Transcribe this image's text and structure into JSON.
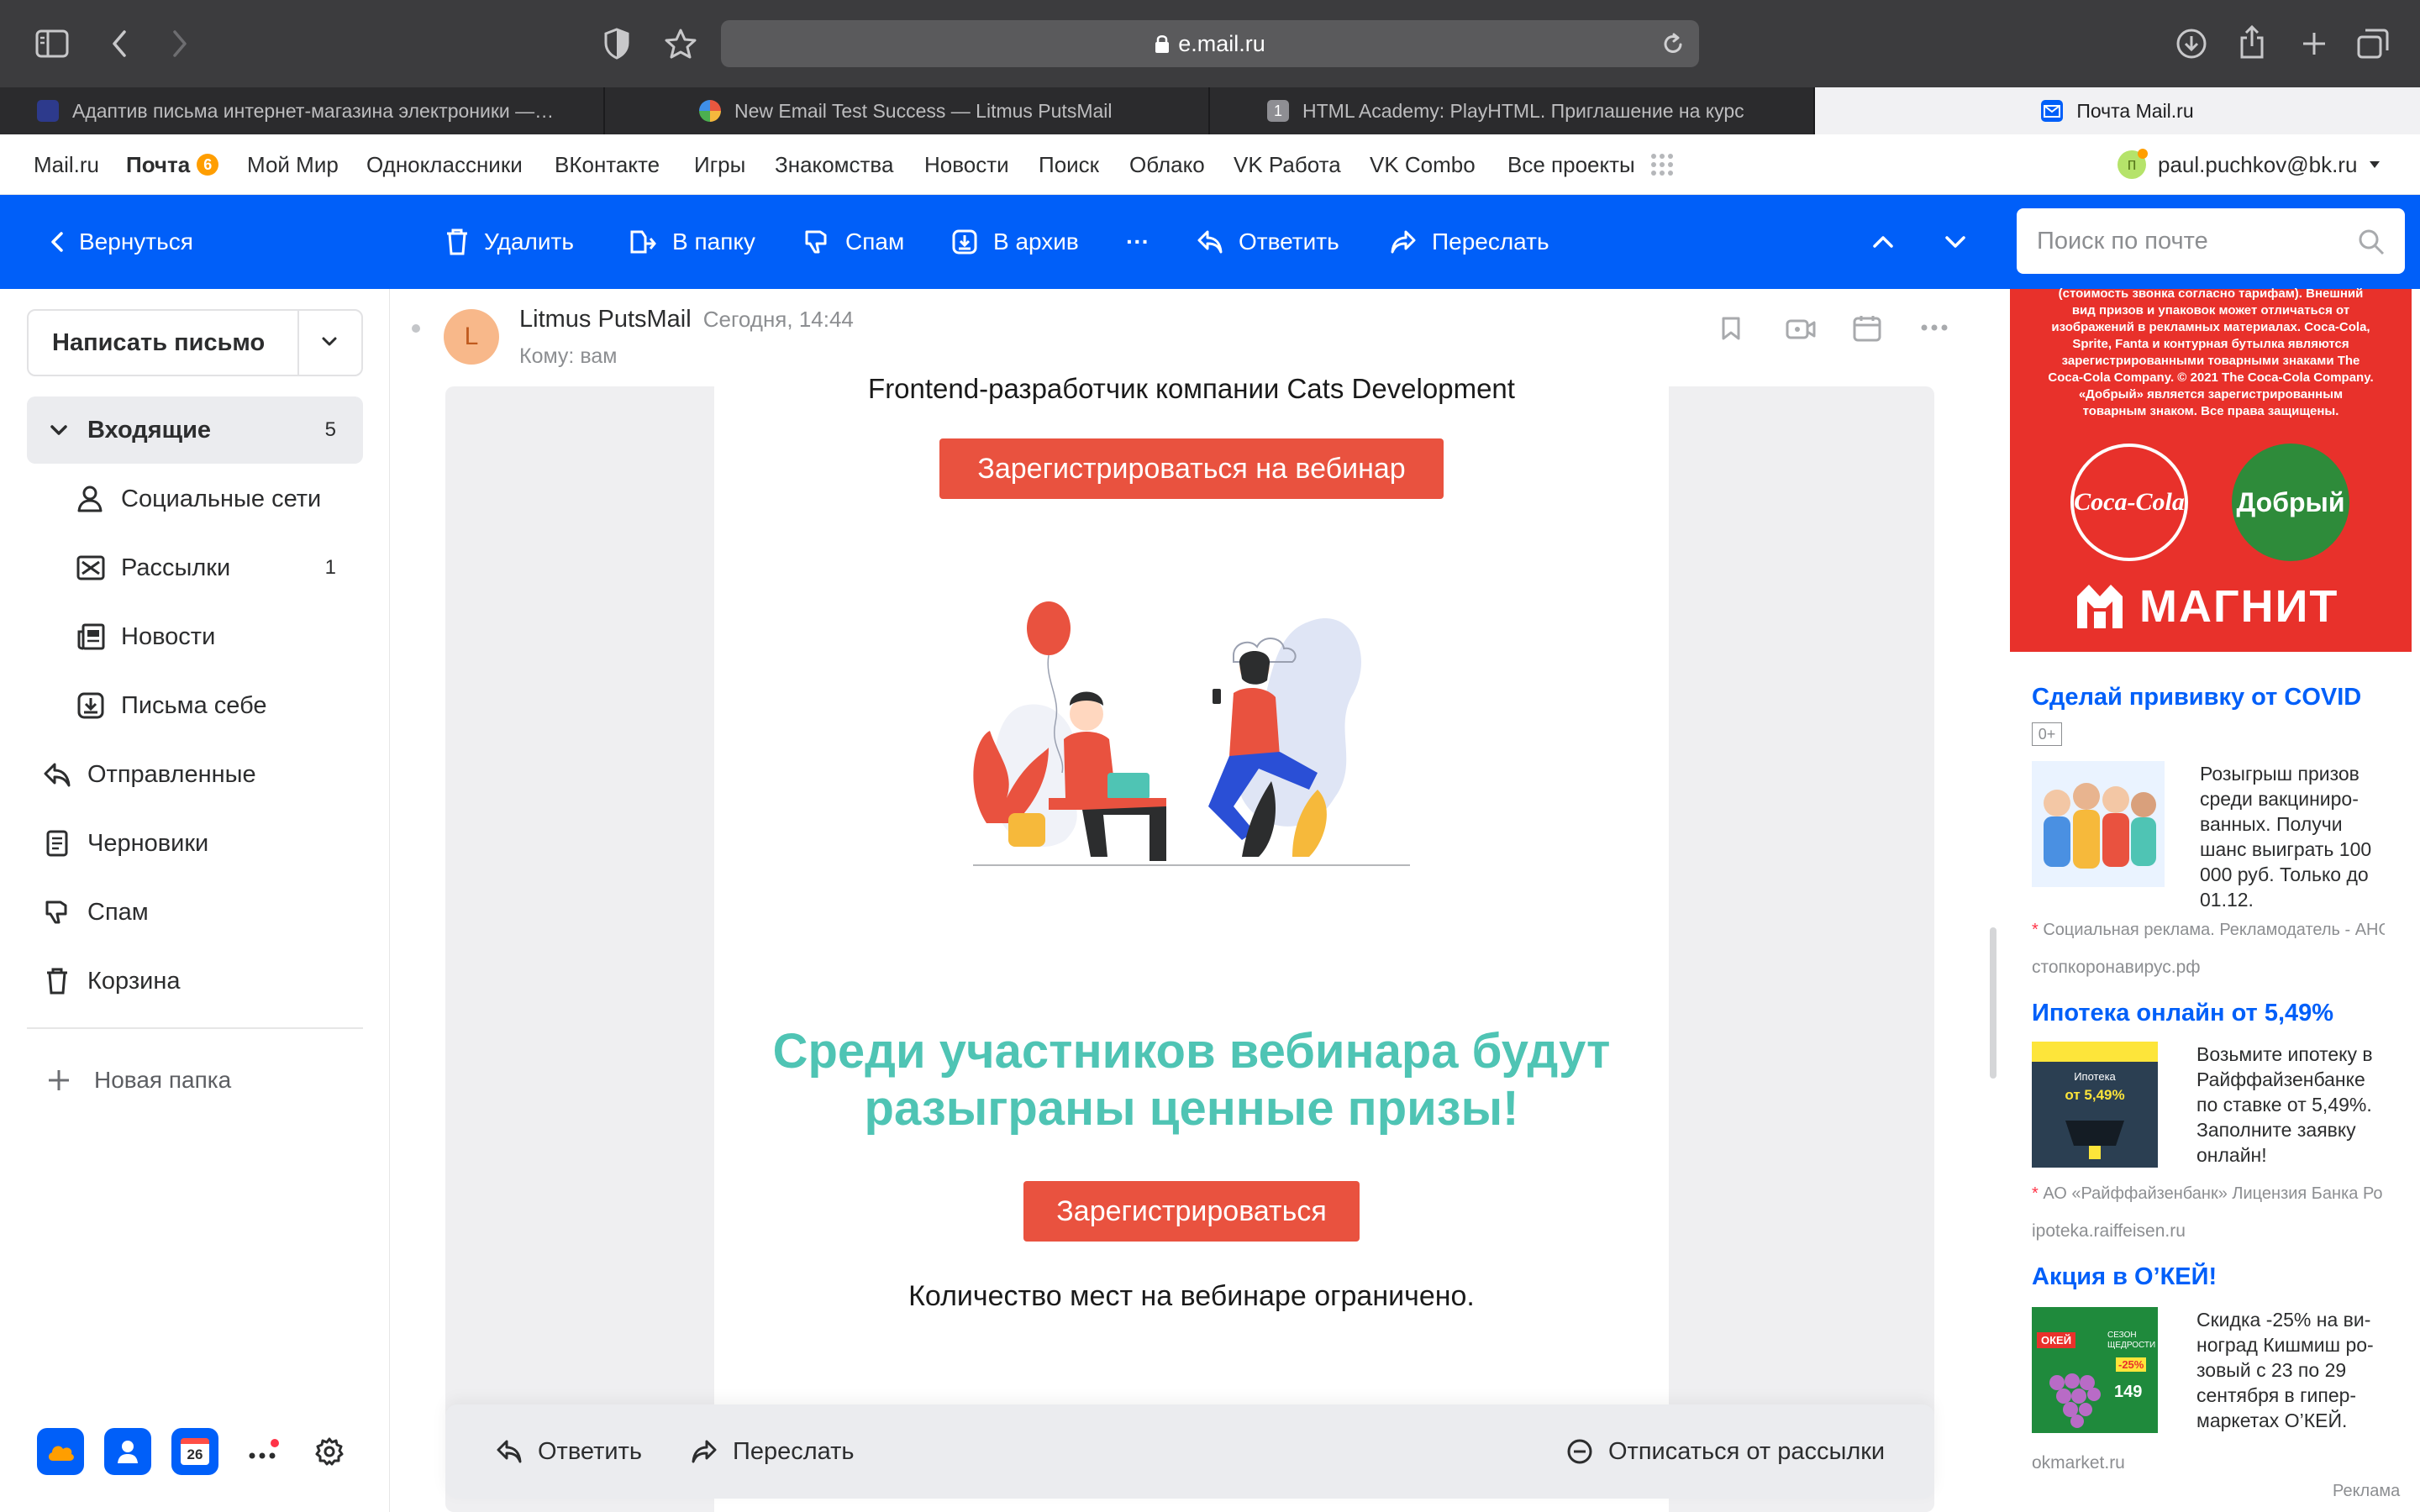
{
  "browser": {
    "url": "e.mail.ru",
    "tabs": [
      {
        "title": "Адаптив письма интернет-магазина электроники —…",
        "favicon_color": "#2d3a8c"
      },
      {
        "title": "New Email Test Success — Litmus PutsMail",
        "favicon_color": "#e9573f"
      },
      {
        "title": "HTML Academy: PlayHTML. Приглашение на курс",
        "favicon_color": "#8e8e93",
        "favicon_text": "1"
      },
      {
        "title": "Почта Mail.ru",
        "favicon_color": "#005ff9",
        "active": true
      }
    ]
  },
  "portal": {
    "links": [
      "Mail.ru",
      "Почта",
      "Мой Мир",
      "Одноклассники",
      "ВКонтакте",
      "Игры",
      "Знакомства",
      "Новости",
      "Поиск",
      "Облако",
      "VK Работа",
      "VK Combo",
      "Все проекты"
    ],
    "mail_badge": "6",
    "user_initial": "п",
    "user_email": "paul.puchkov@bk.ru"
  },
  "toolbar": {
    "back": "Вернуться",
    "delete": "Удалить",
    "move": "В папку",
    "spam": "Спам",
    "archive": "В архив",
    "more": "···",
    "reply": "Ответить",
    "forward": "Переслать",
    "search_placeholder": "Поиск по почте"
  },
  "sidebar": {
    "compose": "Написать письмо",
    "folders": [
      {
        "label": "Входящие",
        "count": "5"
      },
      {
        "label": "Социальные сети",
        "count": ""
      },
      {
        "label": "Рассылки",
        "count": "1"
      },
      {
        "label": "Новости",
        "count": ""
      },
      {
        "label": "Письма себе",
        "count": ""
      },
      {
        "label": "Отправленные",
        "count": ""
      },
      {
        "label": "Черновики",
        "count": ""
      },
      {
        "label": "Спам",
        "count": ""
      },
      {
        "label": "Корзина",
        "count": ""
      }
    ],
    "new_folder": "Новая папка",
    "calendar_day": "26"
  },
  "message": {
    "sender": "Litmus PutsMail",
    "sender_initial": "L",
    "time": "Сегодня, 14:44",
    "to": "Кому: вам",
    "cut_text": "Frontend-разработчик компании Cats Development",
    "button1": "Зарегистрироваться на вебинар",
    "headline_line1": "Среди участников вебинара будут",
    "headline_line2": "разыграны ценные призы!",
    "button2": "Зарегистрироваться",
    "note": "Количество мест на вебинаре ограничено.",
    "accent_color": "#4fc4b4",
    "button_color": "#e9523f"
  },
  "reply_bar": {
    "reply": "Ответить",
    "forward": "Переслать",
    "unsubscribe": "Отписаться от рассылки"
  },
  "ads": {
    "banner_fineprint": [
      "(стоимость звонка согласно тарифам). Внешний",
      "вид призов и упаковок может отличаться от",
      "изображений в рекламных материалах. Coca-Cola,",
      "Sprite, Fanta и контурная бутылка являются",
      "зарегистрированными товарными знаками The",
      "Coca-Cola Company. © 2021 The Coca-Cola Company.",
      "«Добрый» является зарегистрированным",
      "товарным знаком. Все права защищены."
    ],
    "banner_brand1": "Coca-Cola",
    "banner_brand2": "Добрый",
    "banner_brand3": "МАГНИТ",
    "items": [
      {
        "title": "Сделай прививку от COVID",
        "age": "0+",
        "text": [
          "Розыгрыш призов",
          "среди вакциниро-",
          "ванных. Получи",
          "шанс выиграть 100",
          "000 руб. Только до",
          "01.12."
        ],
        "disclaimer": "Социальная реклама. Рекламодатель - АНО",
        "domain": "стопкоронавирус.рф"
      },
      {
        "title": "Ипотека онлайн от 5,49%",
        "text": [
          "Возьмите ипотеку в",
          "Райффайзенбанке",
          "по ставке от 5,49%.",
          "Заполните заявку",
          "онлайн!"
        ],
        "disclaimer": "АО «Райффайзенбанк» Лицензия Банка Ро",
        "domain": "ipoteka.raiffeisen.ru",
        "thumb_label": "Ипотека",
        "thumb_rate": "от 5,49%"
      },
      {
        "title": "Акция в О’КЕЙ!",
        "text": [
          "Скидка -25% на ви-",
          "ноград Кишмиш ро-",
          "зовый с 23 по 29",
          "сентября в гипер-",
          "маркетах О’КЕЙ."
        ],
        "domain": "okmarket.ru",
        "thumb_brand": "ОКЕЙ",
        "thumb_season": "СЕЗОН",
        "thumb_season2": "ЩЕДРОСТИ",
        "thumb_discount": "-25%",
        "thumb_price": "149"
      }
    ],
    "ad_label": "Реклама"
  }
}
